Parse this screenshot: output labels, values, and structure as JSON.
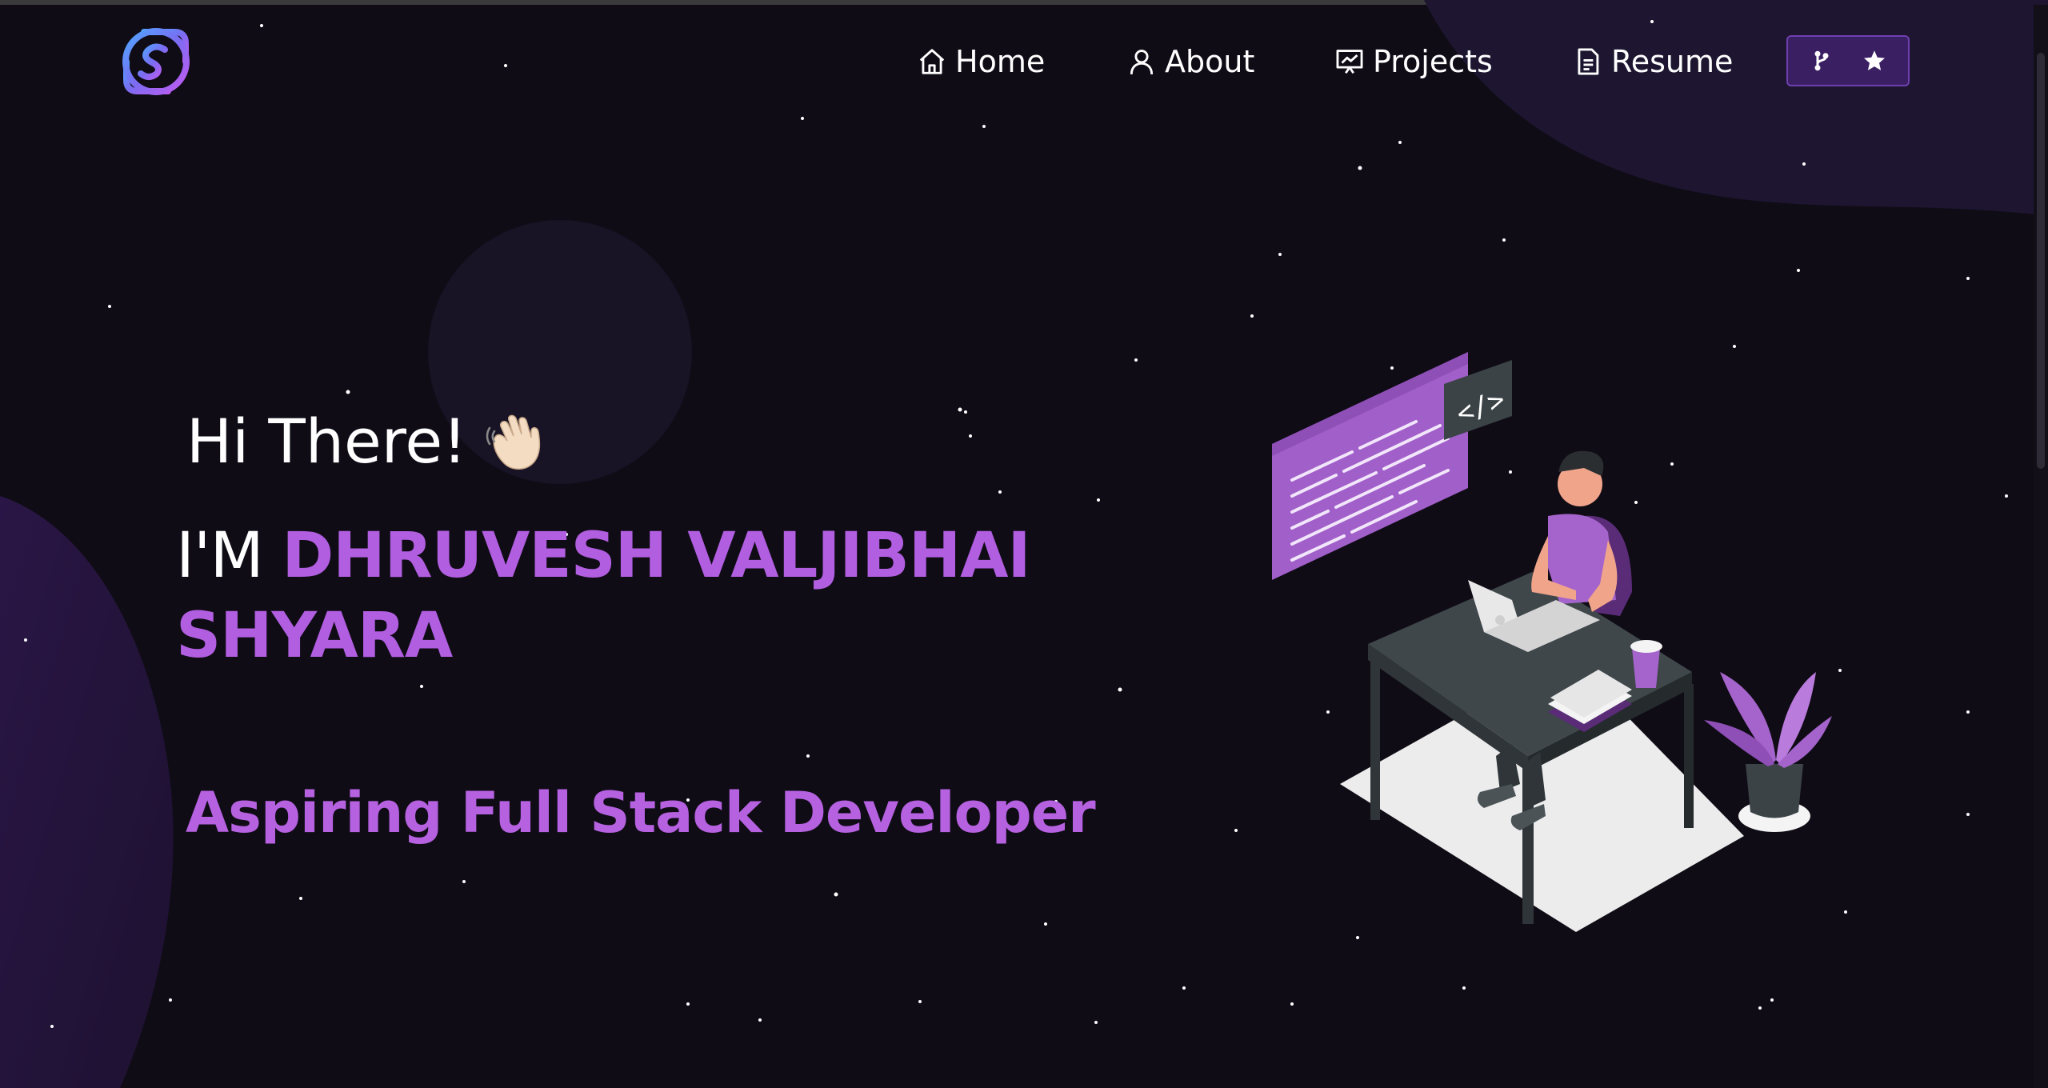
{
  "nav": {
    "logo_icon": "s-logo-icon",
    "items": [
      {
        "label": "Home",
        "icon": "home-icon"
      },
      {
        "label": "About",
        "icon": "user-icon"
      },
      {
        "label": "Projects",
        "icon": "presentation-icon"
      },
      {
        "label": "Resume",
        "icon": "document-icon"
      }
    ],
    "github_button": {
      "icons": [
        "git-fork-icon",
        "star-icon"
      ]
    }
  },
  "hero": {
    "greeting": "Hi There!",
    "greeting_emoji": "waving-hand-icon",
    "name_prefix": "I'M ",
    "name_part1": "DHRUVESH VALJIBHAI",
    "name_part2": "SHYARA",
    "subtitle": "Aspiring Full Stack Developer",
    "illustration": "developer-at-desk-illustration"
  },
  "colors": {
    "background": "#0f0c16",
    "accent": "#b15ee0",
    "button_bg": "#3b1f63"
  }
}
